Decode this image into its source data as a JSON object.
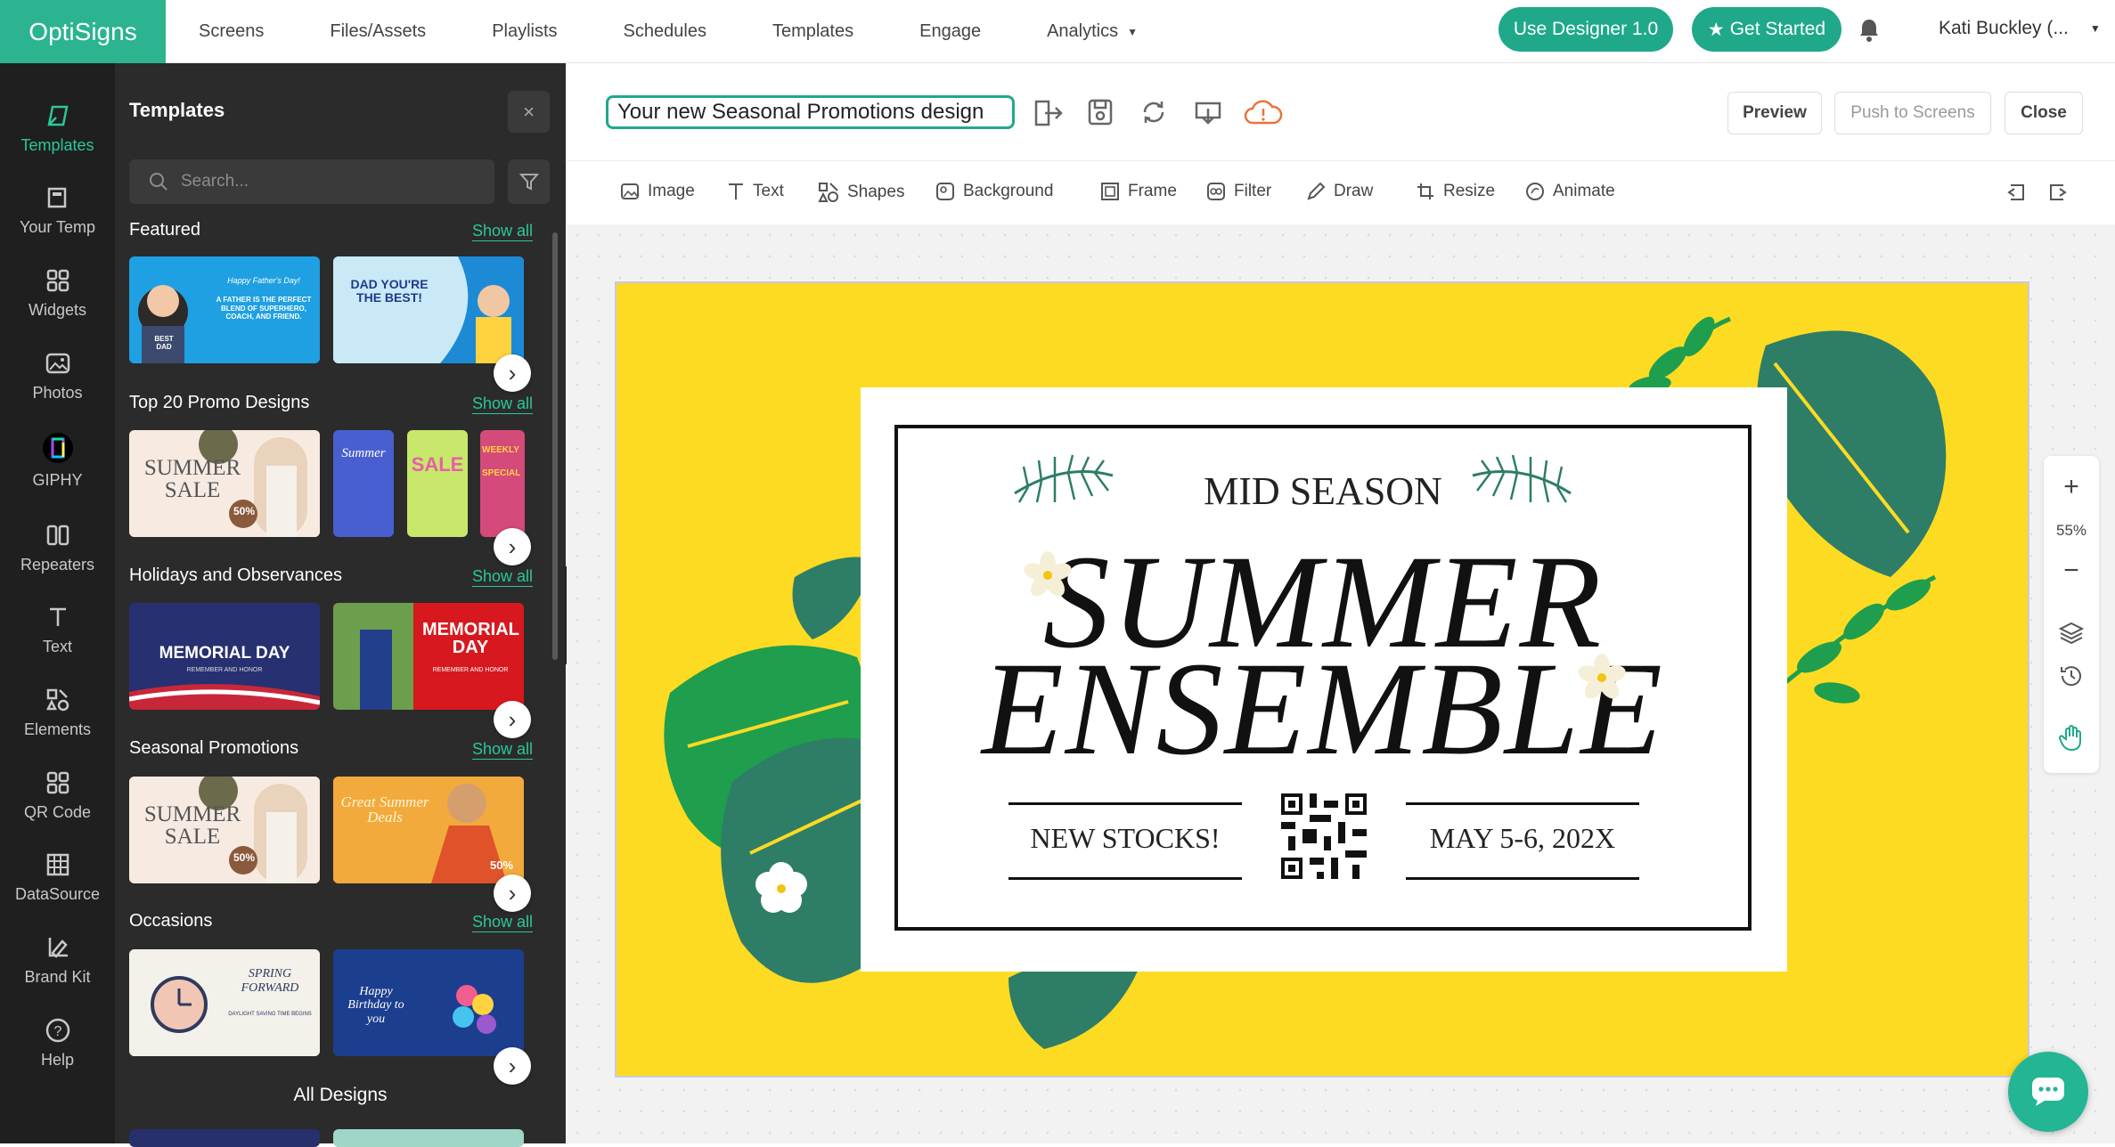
{
  "app": {
    "logo": "OptiSigns"
  },
  "nav": {
    "items": [
      "Screens",
      "Files/Assets",
      "Playlists",
      "Schedules",
      "Templates",
      "Engage",
      "Analytics"
    ]
  },
  "top_buttons": {
    "designer": "Use Designer 1.0",
    "get_started": "Get Started"
  },
  "user": {
    "name": "Kati Buckley (..."
  },
  "rail": {
    "items": [
      "Templates",
      "Your Temp",
      "Widgets",
      "Photos",
      "GIPHY",
      "Repeaters",
      "Text",
      "Elements",
      "QR Code",
      "DataSource",
      "Brand Kit",
      "Help"
    ]
  },
  "panel": {
    "title": "Templates",
    "close": "×",
    "search_placeholder": "Search...",
    "show_all": "Show all",
    "sections": [
      "Featured",
      "Top 20 Promo Designs",
      "Holidays and Observances",
      "Seasonal Promotions",
      "Occasions"
    ],
    "all_designs": "All Designs",
    "thumbs": {
      "featured_1": "Happy Father's Day!",
      "featured_1_b": "A FATHER IS THE PERFECT BLEND OF SUPERHERO, COACH, AND FRIEND.",
      "featured_1_c": "BEST DAD",
      "featured_2": "DAD YOU'RE THE BEST!",
      "promo_1": "SUMMER SALE",
      "promo_1_b": "50%",
      "promo_2": "Summer",
      "promo_3": "SALE",
      "promo_4": "WEEKLY SPECIAL",
      "holiday_1": "MEMORIAL DAY",
      "holiday_1_b": "REMEMBER AND HONOR",
      "holiday_2": "MEMORIAL DAY",
      "holiday_2_b": "REMEMBER AND HONOR",
      "seasonal_1": "SUMMER SALE",
      "seasonal_1_b": "50%",
      "seasonal_2": "Great Summer Deals",
      "seasonal_2_b": "50%",
      "occasion_1": "SPRING FORWARD",
      "occasion_1_b": "DAYLIGHT SAVING TIME BEGINS",
      "occasion_2": "Happy Birthday to you"
    }
  },
  "editor": {
    "doc_name": "Your new Seasonal Promotions design",
    "preview": "Preview",
    "push": "Push to Screens",
    "close": "Close",
    "tools": [
      "Image",
      "Text",
      "Shapes",
      "Background",
      "Frame",
      "Filter",
      "Draw",
      "Resize",
      "Animate"
    ],
    "zoom": "55%"
  },
  "design": {
    "line1": "MID SEASON",
    "line2": "SUMMER",
    "line3": "ENSEMBLE",
    "left": "NEW STOCKS!",
    "right": "MAY 5-6, 202X"
  },
  "colors": {
    "brand": "#2bb48f",
    "design_bg": "#fddb22",
    "leaf": "#2e7d67",
    "leaf_light": "#1f9e4e"
  }
}
